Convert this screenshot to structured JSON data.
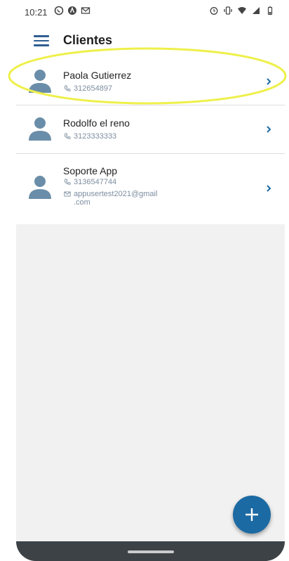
{
  "status_bar": {
    "time": "10:21",
    "left_icons": [
      "whatsapp-icon",
      "a-app-icon",
      "gmail-icon"
    ],
    "right_icons": [
      "alarm-icon",
      "vibrate-icon",
      "wifi-icon",
      "signal-icon",
      "battery-icon"
    ]
  },
  "appbar": {
    "title": "Clientes",
    "menu_icon": "hamburger-menu-icon"
  },
  "clients": [
    {
      "name": "Paola Gutierrez",
      "phone": "312654897"
    },
    {
      "name": "Rodolfo el reno",
      "phone": "3123333333"
    },
    {
      "name": "Soporte App",
      "phone": "3136547744",
      "email_line1": "appusertest2021@gmail",
      "email_line2": ".com"
    }
  ],
  "fab": {
    "icon": "plus-icon"
  },
  "colors": {
    "primary": "#1b6aa3",
    "menu_icon": "#2f5e93",
    "avatar": "#6a8ea9",
    "highlight": "#eef04a"
  }
}
